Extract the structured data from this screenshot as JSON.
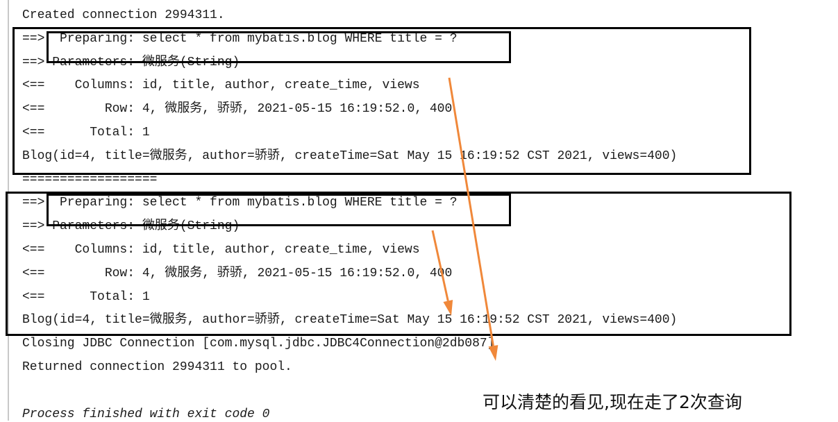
{
  "console": {
    "lines": [
      "Created connection 2994311.",
      "==>  Preparing: select * from mybatis.blog WHERE title = ?",
      "==> Parameters: 微服务(String)",
      "<==    Columns: id, title, author, create_time, views",
      "<==        Row: 4, 微服务, 骄骄, 2021-05-15 16:19:52.0, 400",
      "<==      Total: 1",
      "Blog(id=4, title=微服务, author=骄骄, createTime=Sat May 15 16:19:52 CST 2021, views=400)",
      "==================",
      "==>  Preparing: select * from mybatis.blog WHERE title = ?",
      "==> Parameters: 微服务(String)",
      "<==    Columns: id, title, author, create_time, views",
      "<==        Row: 4, 微服务, 骄骄, 2021-05-15 16:19:52.0, 400",
      "<==      Total: 1",
      "Blog(id=4, title=微服务, author=骄骄, createTime=Sat May 15 16:19:52 CST 2021, views=400)",
      "Closing JDBC Connection [com.mysql.jdbc.JDBC4Connection@2db087]",
      "Returned connection 2994311 to pool.",
      "",
      "Process finished with exit code 0"
    ]
  },
  "annotation": {
    "text": "可以清楚的看见,现在走了2次查询",
    "arrow_color": "#f0883a",
    "box_color": "#000000"
  }
}
